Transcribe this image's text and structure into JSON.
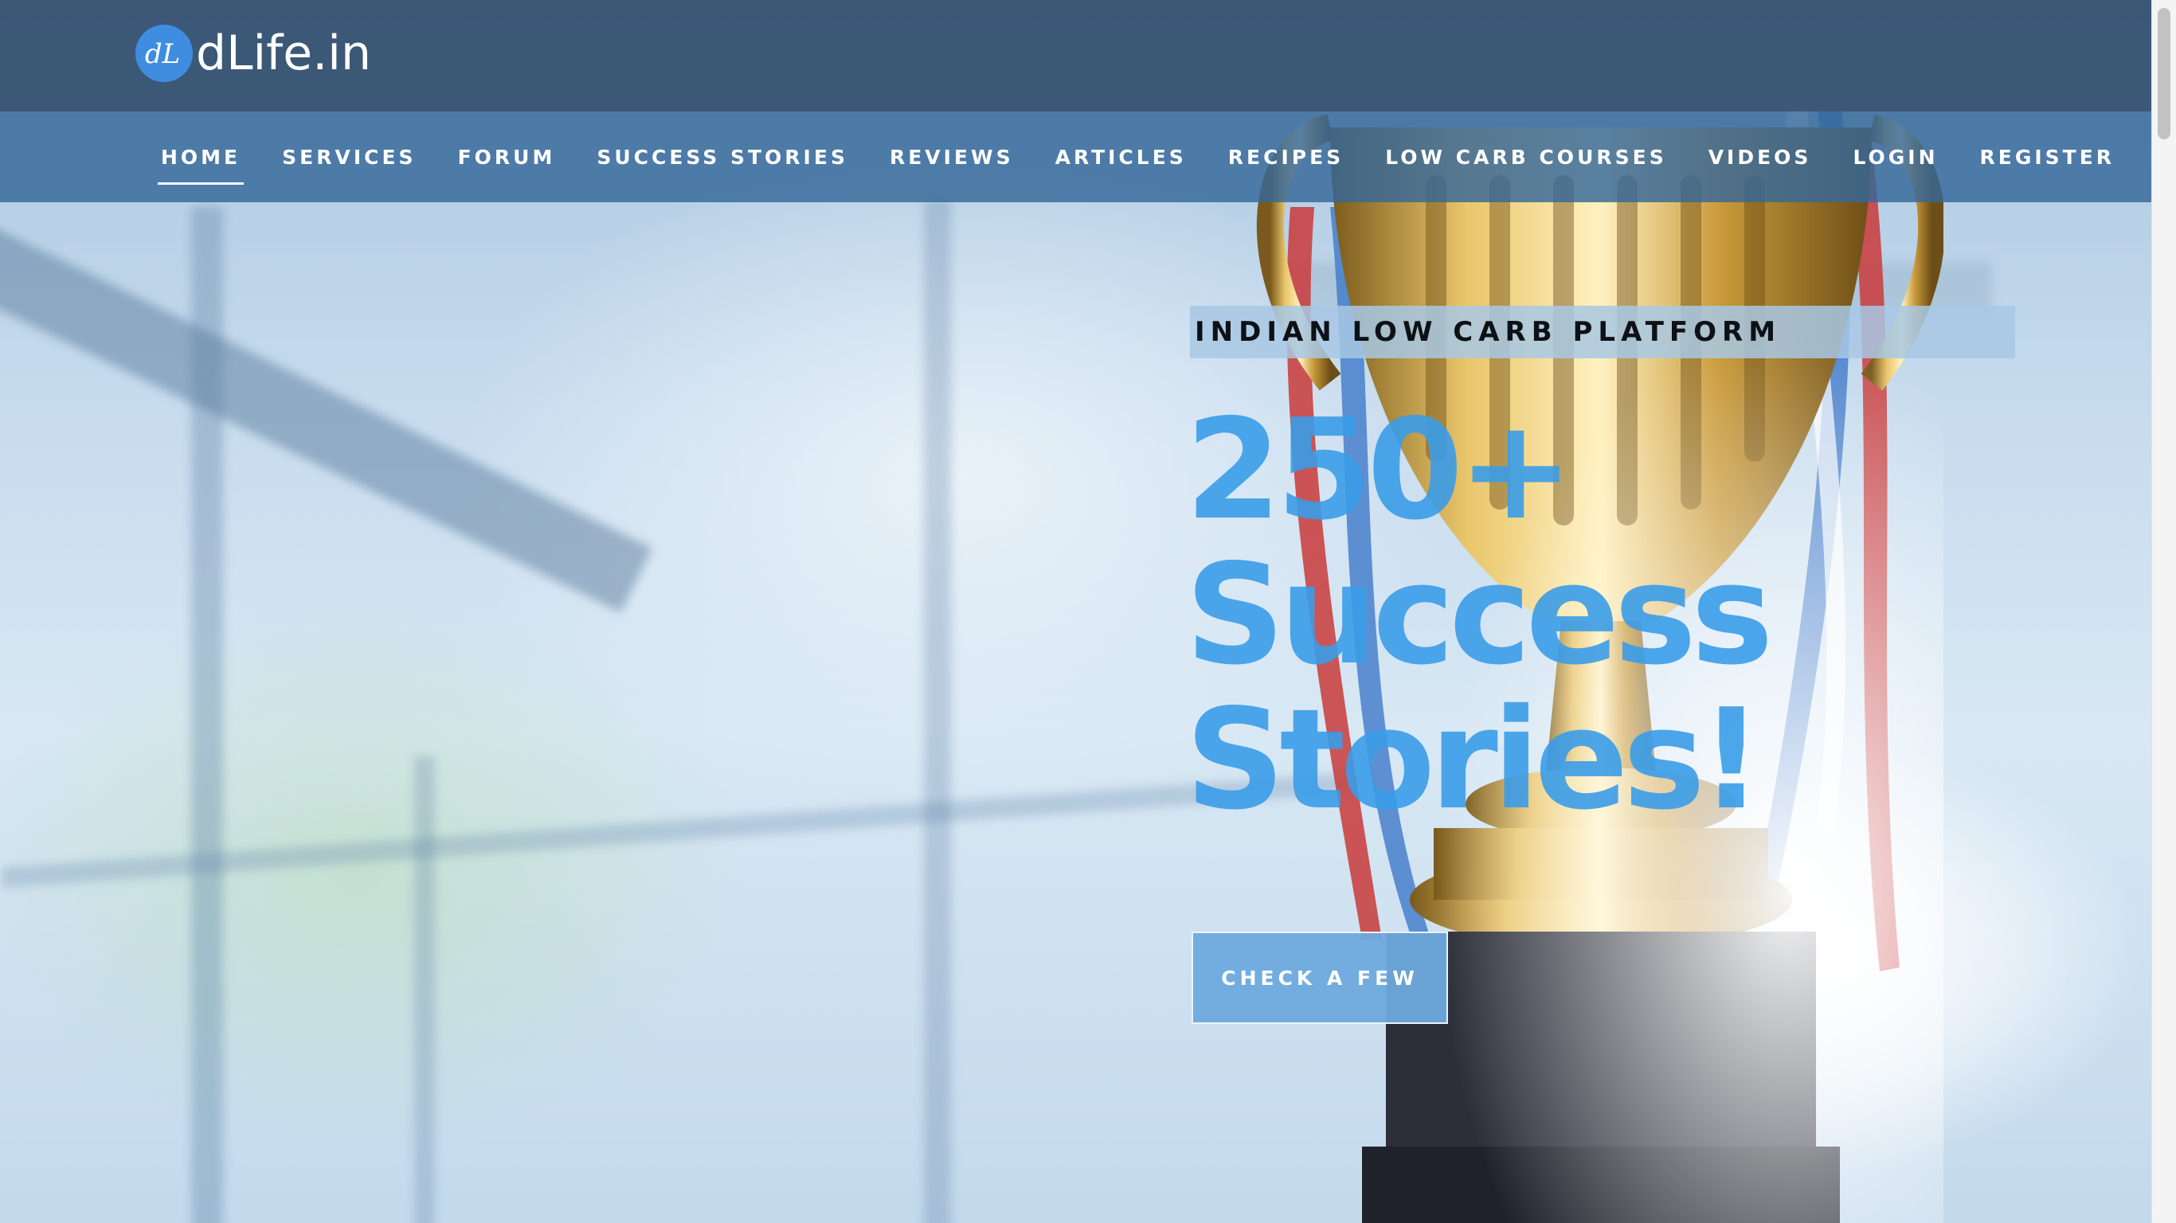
{
  "header": {
    "logo_text": "dLife.in",
    "logo_mark_text": "dL",
    "logo_color": "#3e8de0"
  },
  "nav": {
    "items": [
      {
        "label": "HOME",
        "active": true
      },
      {
        "label": "SERVICES"
      },
      {
        "label": "FORUM"
      },
      {
        "label": "SUCCESS STORIES"
      },
      {
        "label": "REVIEWS"
      },
      {
        "label": "ARTICLES"
      },
      {
        "label": "RECIPES"
      },
      {
        "label": "LOW CARB COURSES"
      },
      {
        "label": "VIDEOS"
      },
      {
        "label": "LOGIN"
      },
      {
        "label": "REGISTER"
      }
    ]
  },
  "hero": {
    "eyebrow": "INDIAN LOW CARB PLATFORM",
    "headline_lines": [
      "250+",
      "Success",
      "Stories!"
    ],
    "cta_label": "CHECK A FEW",
    "headline_color": "#3a9ce8",
    "image_subject": "trophy-image"
  }
}
